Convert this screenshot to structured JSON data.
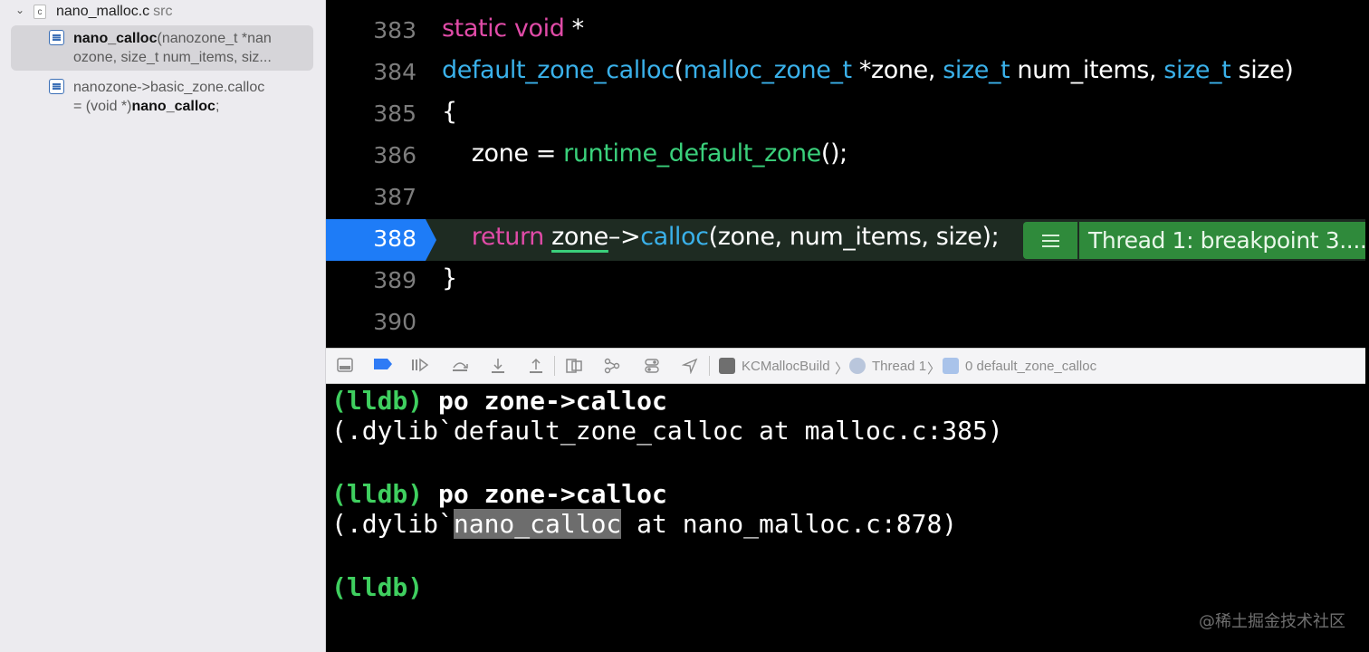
{
  "sidebar": {
    "file": {
      "icon_letter": "c",
      "name": "nano_malloc.c",
      "dir": "src"
    },
    "results": [
      {
        "bold": "nano_calloc",
        "rest_line1": "(nanozone_t *nan",
        "line2": "ozone, size_t num_items, siz..."
      },
      {
        "line1": "nanozone->basic_zone.calloc",
        "line2_pre": "= (void *)",
        "line2_bold": "nano_calloc",
        "line2_post": ";"
      }
    ]
  },
  "editor": {
    "line_numbers": [
      "383",
      "384",
      "385",
      "386",
      "387",
      "388",
      "389",
      "390"
    ],
    "lines": {
      "l383": {
        "kw": "static void",
        "rest": " *"
      },
      "l384": {
        "fn": "default_zone_calloc",
        "p1": "(",
        "t1": "malloc_zone_t",
        "p2": " *zone, ",
        "t2": "size_t",
        "p3": " num_items, ",
        "t3": "size_t",
        "p4": " size)"
      },
      "l385": {
        "text": "{"
      },
      "l386": {
        "p1": "    zone = ",
        "fn": "runtime_default_zone",
        "p2": "();"
      },
      "l388": {
        "indent": "    ",
        "kw": "return",
        "sp": " ",
        "u": "zone",
        "arrow": "–>",
        "fn": "calloc",
        "rest": "(zone, num_items, size);"
      },
      "l389": {
        "text": "}"
      }
    },
    "breakpoint_line": "388",
    "badge_text": "Thread 1: breakpoint 3...."
  },
  "debugbar": {
    "target": "KCMallocBuild",
    "thread": "Thread 1",
    "frame": "0 default_zone_calloc",
    "separator": "〉"
  },
  "console": {
    "prompt": "(lldb)",
    "entries": [
      {
        "command": " po zone->calloc",
        "output": "(.dylib`default_zone_calloc at malloc.c:385)"
      },
      {
        "command": " po zone->calloc",
        "out_pre": "(.dylib`",
        "out_sel": "nano_calloc",
        "out_post": " at nano_malloc.c:878)"
      }
    ]
  },
  "watermark": "@稀土掘金技术社区",
  "colors": {
    "keyword": "#e04ba7",
    "type": "#3ab1ea",
    "function": "#3ad07b",
    "breakpoint": "#1e7cf7",
    "thread_badge": "#2f8a3b",
    "lldb_prompt": "#3fcf5f"
  },
  "icons": {
    "toggle_console": "console-toggle-icon",
    "breakpoints": "breakpoint-toggle-icon",
    "continue": "continue-icon",
    "step_over": "step-over-icon",
    "step_into": "step-into-icon",
    "step_out": "step-out-icon",
    "view_hierarchy": "view-hierarchy-icon",
    "memory_graph": "memory-graph-icon",
    "environment": "environment-overrides-icon",
    "location": "simulate-location-icon"
  }
}
